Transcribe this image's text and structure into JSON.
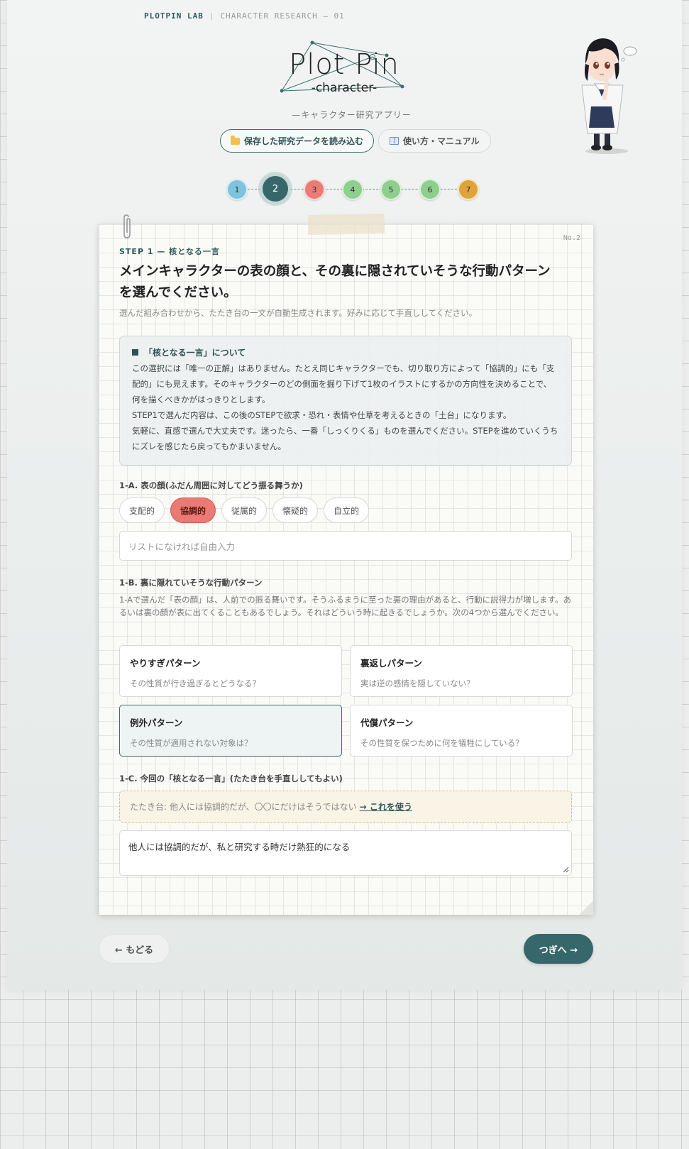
{
  "header": {
    "brand": "PLOTPIN LAB",
    "separator": "|",
    "subtitle": "CHARACTER RESEARCH — 01",
    "logo_title": "Plot Pin",
    "logo_sub": "-character-",
    "tagline": "—キャラクター研究アプリー",
    "load_button": "保存した研究データを読み込む",
    "manual_button": "使い方・マニュアル"
  },
  "stepper": {
    "steps": [
      {
        "label": "1",
        "color": "#7cc3dd"
      },
      {
        "label": "2",
        "color": "#36686b"
      },
      {
        "label": "3",
        "color": "#e97c74"
      },
      {
        "label": "4",
        "color": "#8fcf8d"
      },
      {
        "label": "5",
        "color": "#8fcf8d"
      },
      {
        "label": "6",
        "color": "#8fcf8d"
      },
      {
        "label": "7",
        "color": "#dfa33a"
      }
    ],
    "current": 2
  },
  "page": {
    "page_no": "No.2",
    "step_label": "STEP 1 — 核となる一言",
    "question": "メインキャラクターの表の顔と、その裏に隠されていそうな行動パターンを選んでください。",
    "question_help": "選んだ組み合わせから、たたき台の一文が自動生成されます。好みに応じて手直ししてください。",
    "info": {
      "title": "「核となる一言」について",
      "body": "この選択には「唯一の正解」はありません。たとえ同じキャラクターでも、切り取り方によって「協調的」にも「支配的」にも見えます。そのキャラクターのどの側面を掘り下げて1枚のイラストにするかの方向性を決めることで、何を描くべきかがはっきりとします。",
      "body2": "STEP1で選んだ内容は、この後のSTEPで欲求・恐れ・表情や仕草を考えるときの「土台」になります。",
      "body3": "気軽に、直感で選んで大丈夫です。迷ったら、一番「しっくりくる」ものを選んでください。STEPを進めていくうちにズレを感じたら戻ってもかまいません。"
    },
    "section_a": {
      "label": "1-A. 表の顔(ふだん周囲に対してどう振る舞うか)",
      "chips": [
        "支配的",
        "協調的",
        "従属的",
        "懐疑的",
        "自立的"
      ],
      "selected": "協調的",
      "input_placeholder": "リストになければ自由入力"
    },
    "section_b": {
      "label": "1-B. 裏に隠れていそうな行動パターン",
      "help": "1-Aで選んだ「表の顔」は、人前での振る舞いです。そうふるまうに至った裏の理由があると、行動に説得力が増します。あるいは裏の顔が表に出てくることもあるでしょう。それはどういう時に起きるでしょうか。次の4つから選んでください。",
      "patterns": [
        {
          "title": "やりすぎパターン",
          "desc": "その性質が行き過ぎるとどうなる？"
        },
        {
          "title": "裏返しパターン",
          "desc": "実は逆の感情を隠していない？"
        },
        {
          "title": "例外パターン",
          "desc": "その性質が適用されない対象は？"
        },
        {
          "title": "代償パターン",
          "desc": "その性質を保つために何を犠牲にしている？"
        }
      ],
      "selected": "例外パターン"
    },
    "section_c": {
      "label": "1-C. 今回の「核となる一言」(たたき台を手直ししてもよい)",
      "hint_prefix": "たたき台: 他人には協調的だが、〇〇にだけはそうではない",
      "hint_link": "→ これを使う",
      "final_value": "他人には協調的だが、私と研究する時だけ熱狂的になる"
    }
  },
  "nav": {
    "back": "← もどる",
    "next": "つぎへ →"
  },
  "colors": {
    "accent": "#36686b",
    "chip_selected": "#ea7b74",
    "hint_bg": "#faf4e7"
  }
}
